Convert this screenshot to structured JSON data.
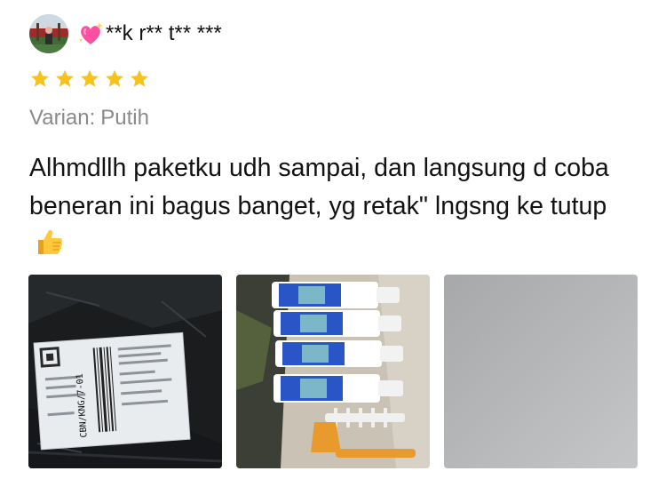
{
  "reviewer": {
    "name": "**k r** t** ***",
    "avatar_icon": "avatar-photo",
    "name_prefix_icon": "sparkling-heart-icon"
  },
  "rating": {
    "stars": 5,
    "max": 5,
    "color": "#F6C21C"
  },
  "variant": {
    "label": "Varian:",
    "value": "Putih"
  },
  "review_text": "Alhmdllh paketku udh sampai, dan langsung d coba beneran ini bagus banget, yg retak\" lngsng ke tutup",
  "review_emoji_icon": "thumbs-up-icon",
  "photos": [
    {
      "name": "package-photo",
      "label_text": "CBN/KNG/7-01"
    },
    {
      "name": "product-tubes-photo",
      "label_text": ""
    },
    {
      "name": "blank-grey-photo",
      "label_text": ""
    }
  ],
  "colors": {
    "text": "#121212",
    "muted": "#8a8a8a",
    "star": "#F6C21C",
    "heart": "#FF4FA0"
  }
}
